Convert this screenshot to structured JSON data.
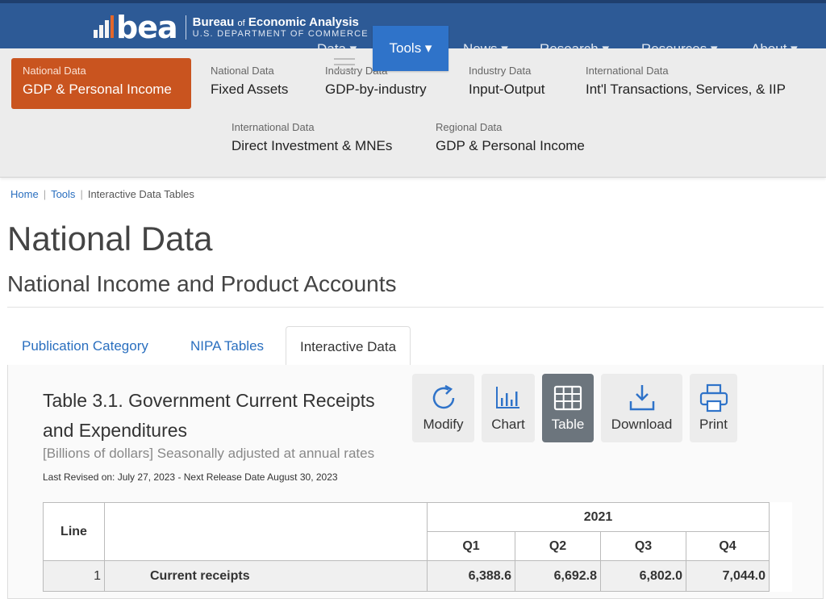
{
  "brand": {
    "logo_word": "bea",
    "name_part1": "Bureau",
    "name_small": "of",
    "name_part2": "Economic Analysis",
    "dept": "U.S. DEPARTMENT OF COMMERCE"
  },
  "topnav": {
    "items": [
      "Data ▾",
      "News ▾",
      "Research ▾",
      "Resources ▾",
      "About ▾"
    ],
    "tools_label": "Tools ▾"
  },
  "mega_menu": {
    "items": [
      {
        "sub": "National Data",
        "main": "GDP & Personal Income"
      },
      {
        "sub": "National Data",
        "main": "Fixed Assets"
      },
      {
        "sub": "Industry Data",
        "main": "GDP-by-industry"
      },
      {
        "sub": "Industry Data",
        "main": "Input-Output"
      },
      {
        "sub": "International Data",
        "main": "Int'l Transactions, Services, & IIP"
      },
      {
        "sub": "International Data",
        "main": "Direct Investment & MNEs"
      },
      {
        "sub": "Regional Data",
        "main": "GDP & Personal Income"
      }
    ]
  },
  "breadcrumb": {
    "home": "Home",
    "tools": "Tools",
    "current": "Interactive Data Tables",
    "sep": "|"
  },
  "page": {
    "title": "National Data",
    "subtitle": "National Income and Product Accounts"
  },
  "tabs": [
    "Publication Category",
    "NIPA Tables",
    "Interactive Data"
  ],
  "table_info": {
    "title": "Table 3.1. Government Current Receipts and Expenditures",
    "units": "[Billions of dollars] Seasonally adjusted at annual rates",
    "revised": "Last Revised on: July 27, 2023 - Next Release Date August 30, 2023"
  },
  "toolbar": {
    "buttons": [
      "Modify",
      "Chart",
      "Table",
      "Download",
      "Print"
    ],
    "active": "Table"
  },
  "data_table": {
    "col_line": "Line",
    "year": "2021",
    "quarters": [
      "Q1",
      "Q2",
      "Q3",
      "Q4"
    ],
    "rows": [
      {
        "line": "1",
        "label": "Current receipts",
        "values": [
          "6,388.6",
          "6,692.8",
          "6,802.0",
          "7,044.0"
        ]
      }
    ]
  },
  "colors": {
    "header": "#2d5a96",
    "accent": "#c9541f",
    "link": "#2a6fbf",
    "tools_btn": "#2f73c9"
  }
}
